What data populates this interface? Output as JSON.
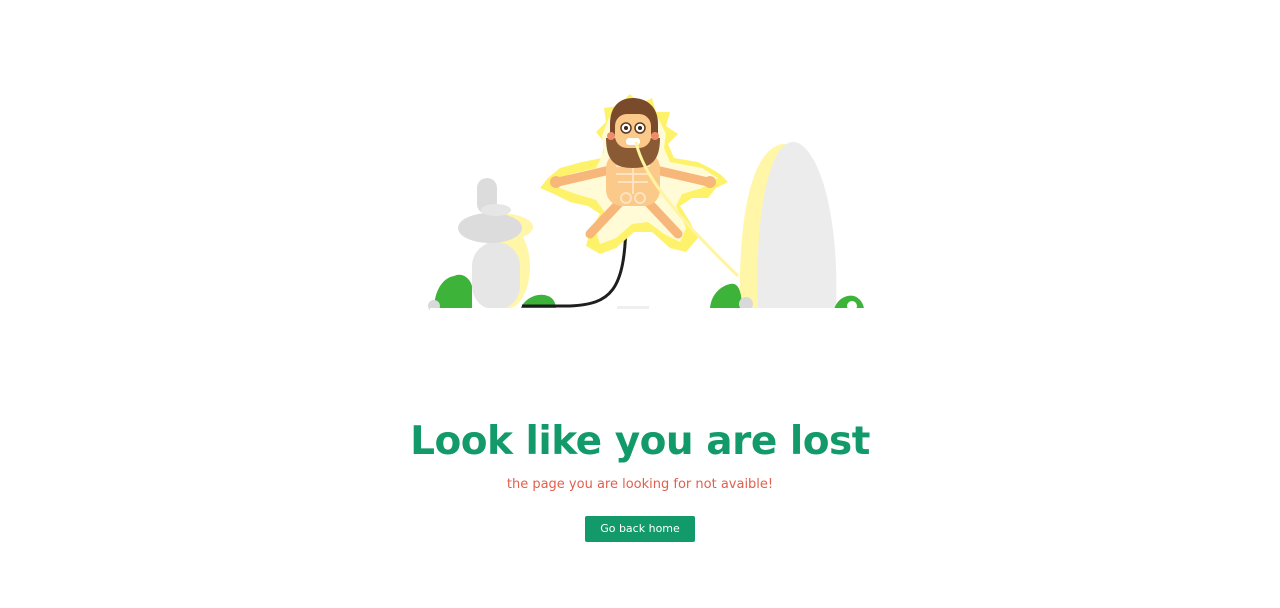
{
  "illustration": {
    "icon": "electrocuted-caveman-illustration",
    "colors": {
      "stone": "#e9e9e9",
      "glow": "#fff6a8",
      "skin": "#fbc98a",
      "bush": "#3db33a",
      "cable": "#1e1e1e",
      "hair": "#7a4b2a"
    }
  },
  "main": {
    "title": "Look like you are lost",
    "subtitle": "the page you are looking for not avaible!",
    "button_label": "Go back home"
  },
  "colors": {
    "accent": "#139a6b",
    "subtitle": "#e0604f",
    "background": "#ffffff"
  }
}
